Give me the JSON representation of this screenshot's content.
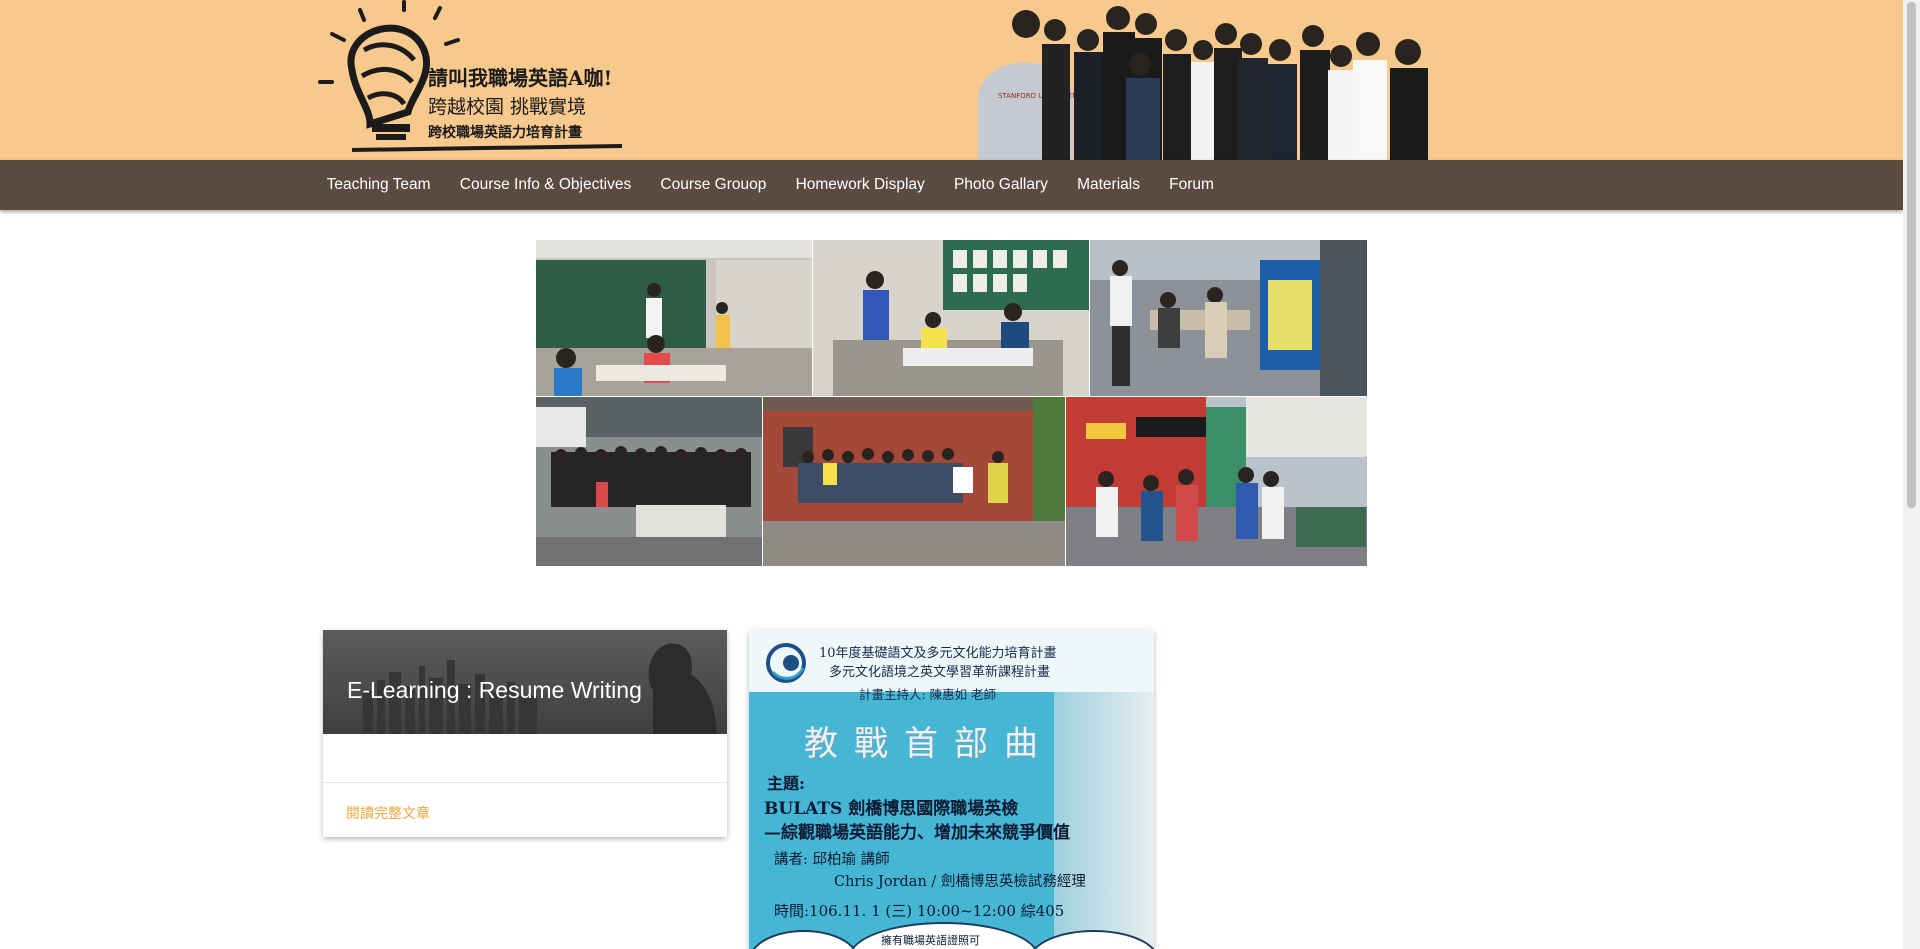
{
  "header": {
    "logo_line1": "請叫我職場英語A咖!",
    "logo_line2": "跨越校園 挑戰實境",
    "logo_line3": "跨校職場英語力培育計畫",
    "brand_color": "#f8c98c",
    "team_sweatshirt_text": "STANFORD UNIVERSITY"
  },
  "nav": {
    "background": "#5b4a40",
    "items": [
      {
        "label": "Teaching Team"
      },
      {
        "label": "Course Info & Objectives"
      },
      {
        "label": "Course Grouop"
      },
      {
        "label": "Homework Display"
      },
      {
        "label": "Photo Gallary"
      },
      {
        "label": "Materials"
      },
      {
        "label": "Forum"
      }
    ]
  },
  "card": {
    "title": "E-Learning : Resume Writing",
    "link_label": "閱讀完整文章",
    "link_color": "#f0a73c"
  },
  "poster": {
    "line1": "10年度基礎語文及多元文化能力培育計畫",
    "line2": "多元文化語境之英文學習革新課程計畫",
    "host": "計畫主持人: 陳惠如 老師",
    "headline": "教戰首部曲",
    "topic_label": "主題:",
    "topic_line1": "BULATS 劍橋博思國際職場英檢",
    "topic_line2": "—綜觀職場英語能力、增加未來競爭價值",
    "speaker_line1": "講者:  邱柏瑜  講師",
    "speaker_line2": "Chris Jordan  /  劍橋博思英檢試務經理",
    "time": "時間:106.11. 1 (三)  10:00~12:00  綜405",
    "bubble_text": "擁有職場英語證照可"
  }
}
